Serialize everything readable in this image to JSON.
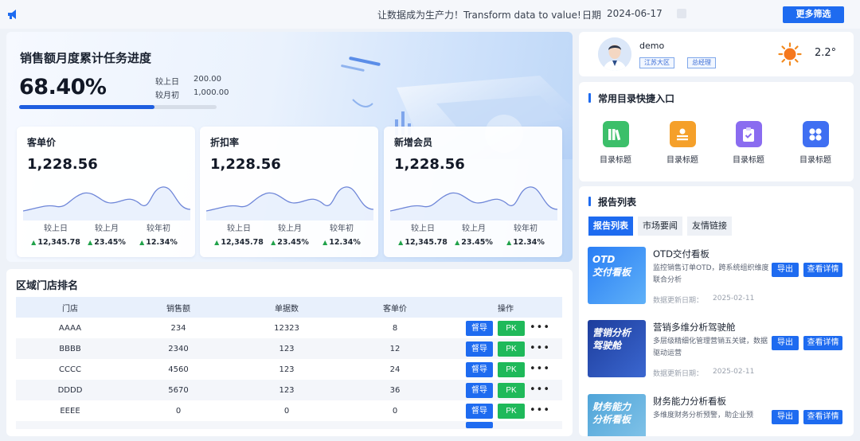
{
  "topbar": {
    "slogan": "让数据成为生产力！Transform data to value!",
    "date_label": "日期",
    "date_value": "2024-06-17",
    "more_filter": "更多筛选"
  },
  "hero": {
    "title": "销售额月度累计任务进度",
    "percent": "68.40%",
    "progress": 0.684,
    "compare": [
      {
        "label": "较上日",
        "value": "200.00"
      },
      {
        "label": "较月初",
        "value": "1,000.00"
      }
    ],
    "cards": [
      {
        "title": "客单价",
        "value": "1,228.56",
        "stats": [
          {
            "label": "较上日",
            "value": "12,345.78"
          },
          {
            "label": "较上月",
            "value": "23.45%"
          },
          {
            "label": "较年初",
            "value": "12.34%"
          }
        ]
      },
      {
        "title": "折扣率",
        "value": "1,228.56",
        "stats": [
          {
            "label": "较上日",
            "value": "12,345.78"
          },
          {
            "label": "较上月",
            "value": "23.45%"
          },
          {
            "label": "较年初",
            "value": "12.34%"
          }
        ]
      },
      {
        "title": "新增会员",
        "value": "1,228.56",
        "stats": [
          {
            "label": "较上日",
            "value": "12,345.78"
          },
          {
            "label": "较上月",
            "value": "23.45%"
          },
          {
            "label": "较年初",
            "value": "12.34%"
          }
        ]
      }
    ]
  },
  "rank": {
    "title": "区域门店排名",
    "columns": [
      "门店",
      "销售额",
      "单据数",
      "客单价",
      "操作"
    ],
    "rows": [
      [
        "AAAA",
        "234",
        "12323",
        "8"
      ],
      [
        "BBBB",
        "2340",
        "123",
        "12"
      ],
      [
        "CCCC",
        "4560",
        "123",
        "24"
      ],
      [
        "DDDD",
        "5670",
        "123",
        "36"
      ],
      [
        "EEEE",
        "0",
        "0",
        "0"
      ]
    ],
    "supervise_label": "督导",
    "pk_label": "PK",
    "more_label": "•••"
  },
  "user": {
    "name": "demo",
    "tags": [
      "江苏大区",
      "总经理"
    ],
    "temperature": "2.2°",
    "weather_icon": "sun-icon"
  },
  "quick": {
    "title": "常用目录快捷入口",
    "items": [
      {
        "label": "目录标题",
        "icon": "books-icon",
        "color": "#3cbf6a"
      },
      {
        "label": "目录标题",
        "icon": "user-card-icon",
        "color": "#f5a02a"
      },
      {
        "label": "目录标题",
        "icon": "clipboard-check-icon",
        "color": "#8a6cf0"
      },
      {
        "label": "目录标题",
        "icon": "grid-icon",
        "color": "#3f6ff2"
      }
    ]
  },
  "report": {
    "title": "报告列表",
    "tabs": [
      "报告列表",
      "市场要闻",
      "友情链接"
    ],
    "date_label": "数据更新日期：",
    "export_label": "导出",
    "detail_label": "查看详情",
    "items": [
      {
        "thumb": "OTD\n交付看板",
        "title": "OTD交付看板",
        "desc": "监控销售订单OTD，跨系统组织维度联合分析",
        "date": "2025-02-11"
      },
      {
        "thumb": "营销分析\n驾驶舱",
        "title": "营销多维分析驾驶舱",
        "desc": "多层级精细化管理营销五关键，数据驱动运营",
        "date": "2025-02-11"
      },
      {
        "thumb": "财务能力\n分析看板",
        "title": "财务能力分析看板",
        "desc": "多维度财务分析预警，助企业预",
        "date": ""
      }
    ]
  },
  "colors": {
    "accent": "#1e6bf0",
    "pk_green": "#1fb95a",
    "up_green": "#21a24a"
  }
}
